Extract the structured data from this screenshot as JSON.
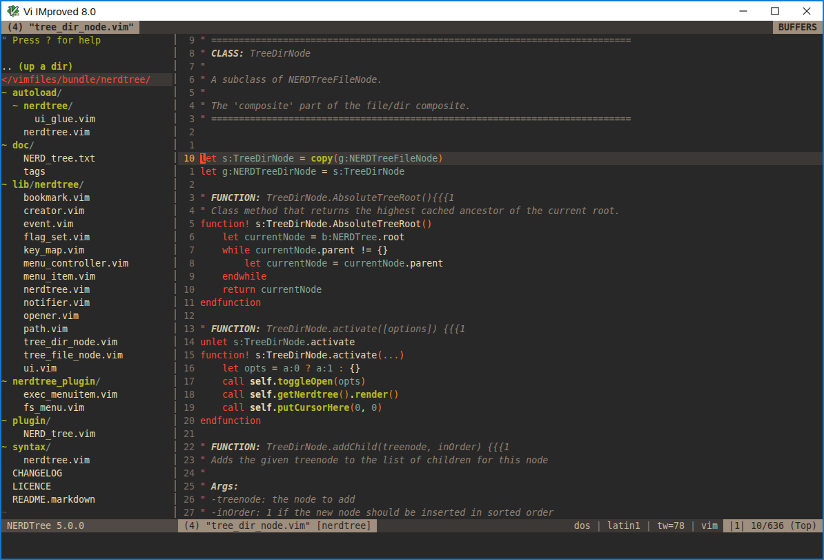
{
  "titlebar": {
    "title": "Vi IMproved 8.0",
    "icon": "vim-logo",
    "controls": [
      "minimize",
      "maximize",
      "close"
    ]
  },
  "tabline": {
    "active_tab": " (4) \"tree_dir_node.vim\" ",
    "right_label": " BUFFERS "
  },
  "colors": {
    "accent_border": "#0c7ad8",
    "titlebar_bg": "#ffffff",
    "titlebar_fg": "#111111",
    "bg0": "#282828",
    "bg1": "#3c3836",
    "bg2": "#504945",
    "bg2l": "#504945",
    "tan": "#9e8f7e",
    "dk": "#2b2622",
    "fg": "#ebdbb2",
    "fg2": "#d5c4a1",
    "fg3": "#c8b999",
    "gray": "#928374",
    "red": "#fb4934",
    "green": "#b6b925",
    "blue": "#83a598",
    "orange": "#fe8019",
    "ylw": "#f5ae2e",
    "lnr": "#7c6f64",
    "curs": "#f9492e",
    "sepc": "#6e645a"
  },
  "nerdtree": {
    "cursor_row": 3,
    "rows": [
      [
        [
          "\" ",
          "cm"
        ],
        [
          "Press ? for help",
          "grnp"
        ]
      ],
      [],
      [
        [
          ".. ",
          "fg"
        ],
        [
          "(up a dir)",
          "grn"
        ]
      ],
      [
        [
          "</vimfiles/bundle/nerdtree/",
          "red"
        ]
      ],
      [
        [
          "~ ",
          "grnp"
        ],
        [
          "autoload",
          "grn"
        ],
        [
          "/",
          "blue"
        ]
      ],
      [
        [
          "  ~ ",
          "grnp"
        ],
        [
          "nerdtree",
          "grn"
        ],
        [
          "/",
          "blue"
        ]
      ],
      [
        [
          "      ui_glue.vim",
          "fg"
        ]
      ],
      [
        [
          "    nerdtree.vim",
          "fg"
        ]
      ],
      [
        [
          "~ ",
          "grnp"
        ],
        [
          "doc",
          "grn"
        ],
        [
          "/",
          "blue"
        ]
      ],
      [
        [
          "    NERD_tree.txt",
          "fg"
        ]
      ],
      [
        [
          "    tags",
          "fg"
        ]
      ],
      [
        [
          "~ ",
          "grnp"
        ],
        [
          "lib",
          "grn"
        ],
        [
          "/",
          "blue"
        ],
        [
          "nerdtree",
          "grn"
        ],
        [
          "/",
          "blue"
        ]
      ],
      [
        [
          "    bookmark.vim",
          "fg"
        ]
      ],
      [
        [
          "    creator.vim",
          "fg"
        ]
      ],
      [
        [
          "    event.vim",
          "fg"
        ]
      ],
      [
        [
          "    flag_set.vim",
          "fg"
        ]
      ],
      [
        [
          "    key_map.vim",
          "fg"
        ]
      ],
      [
        [
          "    menu_controller.vim",
          "fg"
        ]
      ],
      [
        [
          "    menu_item.vim",
          "fg"
        ]
      ],
      [
        [
          "    nerdtree.vim",
          "fg"
        ]
      ],
      [
        [
          "    notifier.vim",
          "fg"
        ]
      ],
      [
        [
          "    opener.vim",
          "fg"
        ]
      ],
      [
        [
          "    path.vim",
          "fg"
        ]
      ],
      [
        [
          "    tree_dir_node.vim",
          "fg"
        ]
      ],
      [
        [
          "    tree_file_node.vim",
          "fg"
        ]
      ],
      [
        [
          "    ui.vim",
          "fg"
        ]
      ],
      [
        [
          "~ ",
          "grnp"
        ],
        [
          "nerdtree_plugin",
          "grn"
        ],
        [
          "/",
          "blue"
        ]
      ],
      [
        [
          "    exec_menuitem.vim",
          "fg"
        ]
      ],
      [
        [
          "    fs_menu.vim",
          "fg"
        ]
      ],
      [
        [
          "~ ",
          "grnp"
        ],
        [
          "plugin",
          "grn"
        ],
        [
          "/",
          "blue"
        ]
      ],
      [
        [
          "    NERD_tree.vim",
          "fg"
        ]
      ],
      [
        [
          "~ ",
          "grnp"
        ],
        [
          "syntax",
          "grn"
        ],
        [
          "/",
          "blue"
        ]
      ],
      [
        [
          "    nerdtree.vim",
          "fg"
        ]
      ],
      [
        [
          "  CHANGELOG",
          "fg"
        ]
      ],
      [
        [
          "  LICENCE",
          "fg"
        ]
      ],
      [
        [
          "  README.markdown",
          "fg"
        ]
      ],
      [
        [
          "~",
          "dim"
        ]
      ]
    ]
  },
  "code": {
    "cursor_row": 9,
    "rows": [
      {
        "num": "9",
        "tokens": [
          [
            "\" ============================================================================",
            "cm"
          ]
        ]
      },
      {
        "num": "8",
        "tokens": [
          [
            "\" ",
            "cm"
          ],
          [
            "CLASS:",
            "cmt"
          ],
          [
            " TreeDirNode",
            "cm"
          ]
        ]
      },
      {
        "num": "7",
        "tokens": [
          [
            "\"",
            "cm"
          ]
        ]
      },
      {
        "num": "6",
        "tokens": [
          [
            "\" A subclass of NERDTreeFileNode.",
            "cm"
          ]
        ]
      },
      {
        "num": "5",
        "tokens": [
          [
            "\"",
            "cm"
          ]
        ]
      },
      {
        "num": "4",
        "tokens": [
          [
            "\" The 'composite' part of the file/dir composite.",
            "cm"
          ]
        ]
      },
      {
        "num": "3",
        "tokens": [
          [
            "\" ============================================================================",
            "cm"
          ]
        ]
      },
      {
        "num": "2",
        "tokens": []
      },
      {
        "num": "1",
        "tokens": []
      },
      {
        "num": "10",
        "cur": true,
        "tokens": [
          [
            "l",
            "curs"
          ],
          [
            "et",
            "red"
          ],
          [
            " ",
            "fg"
          ],
          [
            "s:TreeDirNode",
            "blue"
          ],
          [
            " = ",
            "fg"
          ],
          [
            "copy",
            "grn"
          ],
          [
            "(",
            "org"
          ],
          [
            "g:NERDTreeFileNode",
            "blue"
          ],
          [
            ")",
            "org"
          ]
        ]
      },
      {
        "num": "1",
        "tokens": [
          [
            "let",
            "red"
          ],
          [
            " ",
            "fg"
          ],
          [
            "g:NERDTreeDirNode",
            "blue"
          ],
          [
            " = ",
            "fg"
          ],
          [
            "s:TreeDirNode",
            "blue"
          ]
        ]
      },
      {
        "num": "2",
        "tokens": []
      },
      {
        "num": "3",
        "tokens": [
          [
            "\" ",
            "cm"
          ],
          [
            "FUNCTION:",
            "cmt"
          ],
          [
            " TreeDirNode.AbsoluteTreeRoot(){{{1",
            "cm"
          ]
        ]
      },
      {
        "num": "4",
        "tokens": [
          [
            "\" Class method that returns the highest cached ancestor of the current root.",
            "cm"
          ]
        ]
      },
      {
        "num": "5",
        "tokens": [
          [
            "function!",
            "red"
          ],
          [
            " ",
            "fg"
          ],
          [
            "s:TreeDirNode.AbsoluteTreeRoot",
            "fg"
          ],
          [
            "()",
            "org"
          ]
        ]
      },
      {
        "num": "6",
        "tokens": [
          [
            "    ",
            "fg"
          ],
          [
            "let",
            "red"
          ],
          [
            " ",
            "fg"
          ],
          [
            "currentNode",
            "blue"
          ],
          [
            " = ",
            "fg"
          ],
          [
            "b:NERDTree",
            "blue"
          ],
          [
            ".root",
            "fg"
          ]
        ]
      },
      {
        "num": "7",
        "tokens": [
          [
            "    ",
            "fg"
          ],
          [
            "while",
            "red"
          ],
          [
            " ",
            "fg"
          ],
          [
            "currentNode",
            "blue"
          ],
          [
            ".parent != {}",
            "fg"
          ]
        ]
      },
      {
        "num": "8",
        "tokens": [
          [
            "        ",
            "fg"
          ],
          [
            "let",
            "red"
          ],
          [
            " ",
            "fg"
          ],
          [
            "currentNode",
            "blue"
          ],
          [
            " = ",
            "fg"
          ],
          [
            "currentNode",
            "blue"
          ],
          [
            ".parent",
            "fg"
          ]
        ]
      },
      {
        "num": "9",
        "tokens": [
          [
            "    ",
            "fg"
          ],
          [
            "endwhile",
            "red"
          ]
        ]
      },
      {
        "num": "10",
        "tokens": [
          [
            "    ",
            "fg"
          ],
          [
            "return",
            "red"
          ],
          [
            " ",
            "fg"
          ],
          [
            "currentNode",
            "blue"
          ]
        ]
      },
      {
        "num": "11",
        "tokens": [
          [
            "endfunction",
            "red"
          ]
        ]
      },
      {
        "num": "12",
        "tokens": []
      },
      {
        "num": "13",
        "tokens": [
          [
            "\" ",
            "cm"
          ],
          [
            "FUNCTION:",
            "cmt"
          ],
          [
            " TreeDirNode.activate([options]) {{{1",
            "cm"
          ]
        ]
      },
      {
        "num": "14",
        "tokens": [
          [
            "unlet",
            "red"
          ],
          [
            " ",
            "fg"
          ],
          [
            "s:TreeDirNode",
            "blue"
          ],
          [
            ".activate",
            "fg"
          ]
        ]
      },
      {
        "num": "15",
        "tokens": [
          [
            "function!",
            "red"
          ],
          [
            " ",
            "fg"
          ],
          [
            "s:TreeDirNode.activate",
            "fg"
          ],
          [
            "(...)",
            "org"
          ]
        ]
      },
      {
        "num": "16",
        "tokens": [
          [
            "    ",
            "fg"
          ],
          [
            "let",
            "red"
          ],
          [
            " ",
            "fg"
          ],
          [
            "opts",
            "blue"
          ],
          [
            " = ",
            "fg"
          ],
          [
            "a:0",
            "blue"
          ],
          [
            " ",
            "fg"
          ],
          [
            "?",
            "org"
          ],
          [
            " ",
            "fg"
          ],
          [
            "a:1",
            "blue"
          ],
          [
            " ",
            "fg"
          ],
          [
            ":",
            "org"
          ],
          [
            " {}",
            "fg"
          ]
        ]
      },
      {
        "num": "17",
        "tokens": [
          [
            "    ",
            "fg"
          ],
          [
            "call",
            "red"
          ],
          [
            " ",
            "fg"
          ],
          [
            "self.",
            "fgb"
          ],
          [
            "toggleOpen",
            "grn"
          ],
          [
            "(",
            "org"
          ],
          [
            "opts",
            "blue"
          ],
          [
            ")",
            "org"
          ]
        ]
      },
      {
        "num": "18",
        "tokens": [
          [
            "    ",
            "fg"
          ],
          [
            "call",
            "red"
          ],
          [
            " ",
            "fg"
          ],
          [
            "self.",
            "fgb"
          ],
          [
            "getNerdtree",
            "grn"
          ],
          [
            "()",
            "org"
          ],
          [
            ".",
            "fgb"
          ],
          [
            "render",
            "grn"
          ],
          [
            "()",
            "org"
          ]
        ]
      },
      {
        "num": "19",
        "tokens": [
          [
            "    ",
            "fg"
          ],
          [
            "call",
            "red"
          ],
          [
            " ",
            "fg"
          ],
          [
            "self.",
            "fgb"
          ],
          [
            "putCursorHere",
            "grn"
          ],
          [
            "(",
            "org"
          ],
          [
            "0",
            "blue"
          ],
          [
            ", ",
            "fg"
          ],
          [
            "0",
            "blue"
          ],
          [
            ")",
            "org"
          ]
        ]
      },
      {
        "num": "20",
        "tokens": [
          [
            "endfunction",
            "red"
          ]
        ]
      },
      {
        "num": "21",
        "tokens": []
      },
      {
        "num": "22",
        "tokens": [
          [
            "\" ",
            "cm"
          ],
          [
            "FUNCTION:",
            "cmt"
          ],
          [
            " TreeDirNode.addChild(treenode, inOrder) {{{1",
            "cm"
          ]
        ]
      },
      {
        "num": "23",
        "tokens": [
          [
            "\" Adds the given treenode to the list of children for this node",
            "cm"
          ]
        ]
      },
      {
        "num": "24",
        "tokens": [
          [
            "\"",
            "cm"
          ]
        ]
      },
      {
        "num": "25",
        "tokens": [
          [
            "\" ",
            "cm"
          ],
          [
            "Args:",
            "cmt"
          ]
        ]
      },
      {
        "num": "26",
        "tokens": [
          [
            "\" -treenode: the node to add",
            "cm"
          ]
        ]
      },
      {
        "num": "27",
        "tokens": [
          [
            "\" -inOrder: 1 if the new node should be inserted in sorted order",
            "cm"
          ]
        ]
      }
    ]
  },
  "statusline": {
    "nerdtree": " NERDTree 5.0.0",
    "file": " (4) \"tree_dir_node.vim\" [nerdtree]",
    "info_parts": [
      "dos",
      "latin1",
      "tw=78",
      "vim"
    ],
    "info_separator": "|",
    "position": " |1| 10/636 (Top) "
  },
  "command_line": ""
}
